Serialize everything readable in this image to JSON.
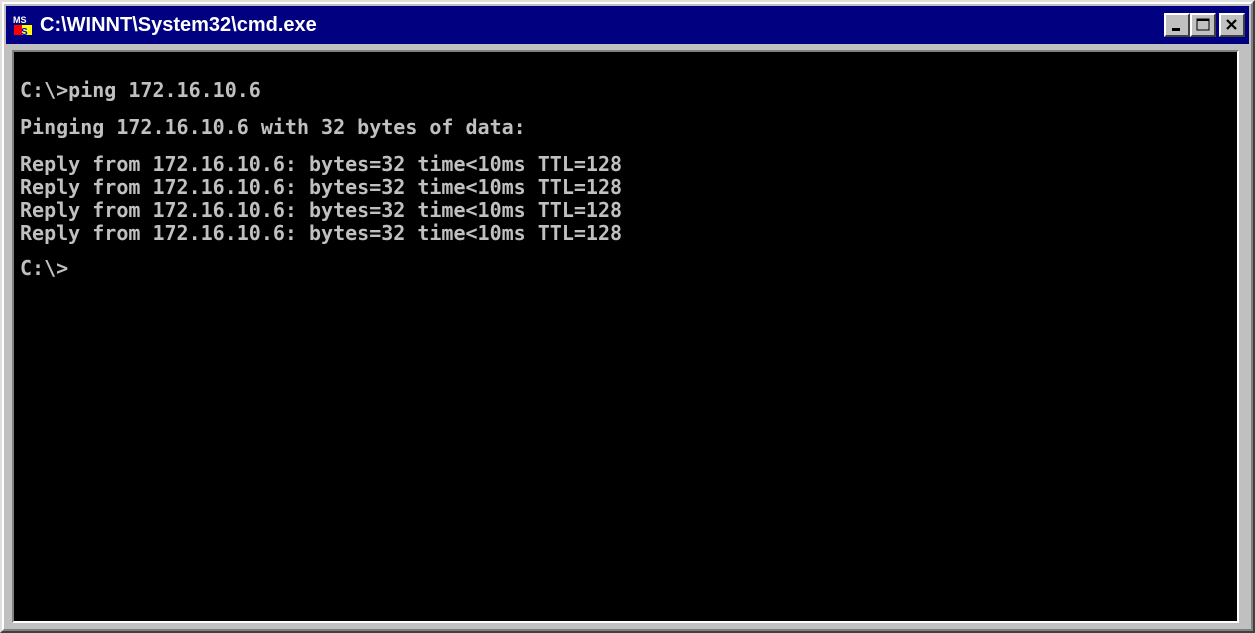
{
  "window": {
    "title": "C:\\WINNT\\System32\\cmd.exe",
    "icon": "ms-dos-icon",
    "caption_buttons": [
      "minimize-icon",
      "maximize-icon",
      "close-icon"
    ]
  },
  "console": {
    "lines": [
      "C:\\>ping 172.16.10.6",
      "Pinging 172.16.10.6 with 32 bytes of data:",
      "Reply from 172.16.10.6: bytes=32 time<10ms TTL=128",
      "Reply from 172.16.10.6: bytes=32 time<10ms TTL=128",
      "Reply from 172.16.10.6: bytes=32 time<10ms TTL=128",
      "Reply from 172.16.10.6: bytes=32 time<10ms TTL=128",
      "C:\\>"
    ]
  },
  "colors": {
    "titlebar": "#000080",
    "console_bg": "#000000",
    "console_text": "#c0c0c0",
    "chrome": "#c0c0c0"
  }
}
